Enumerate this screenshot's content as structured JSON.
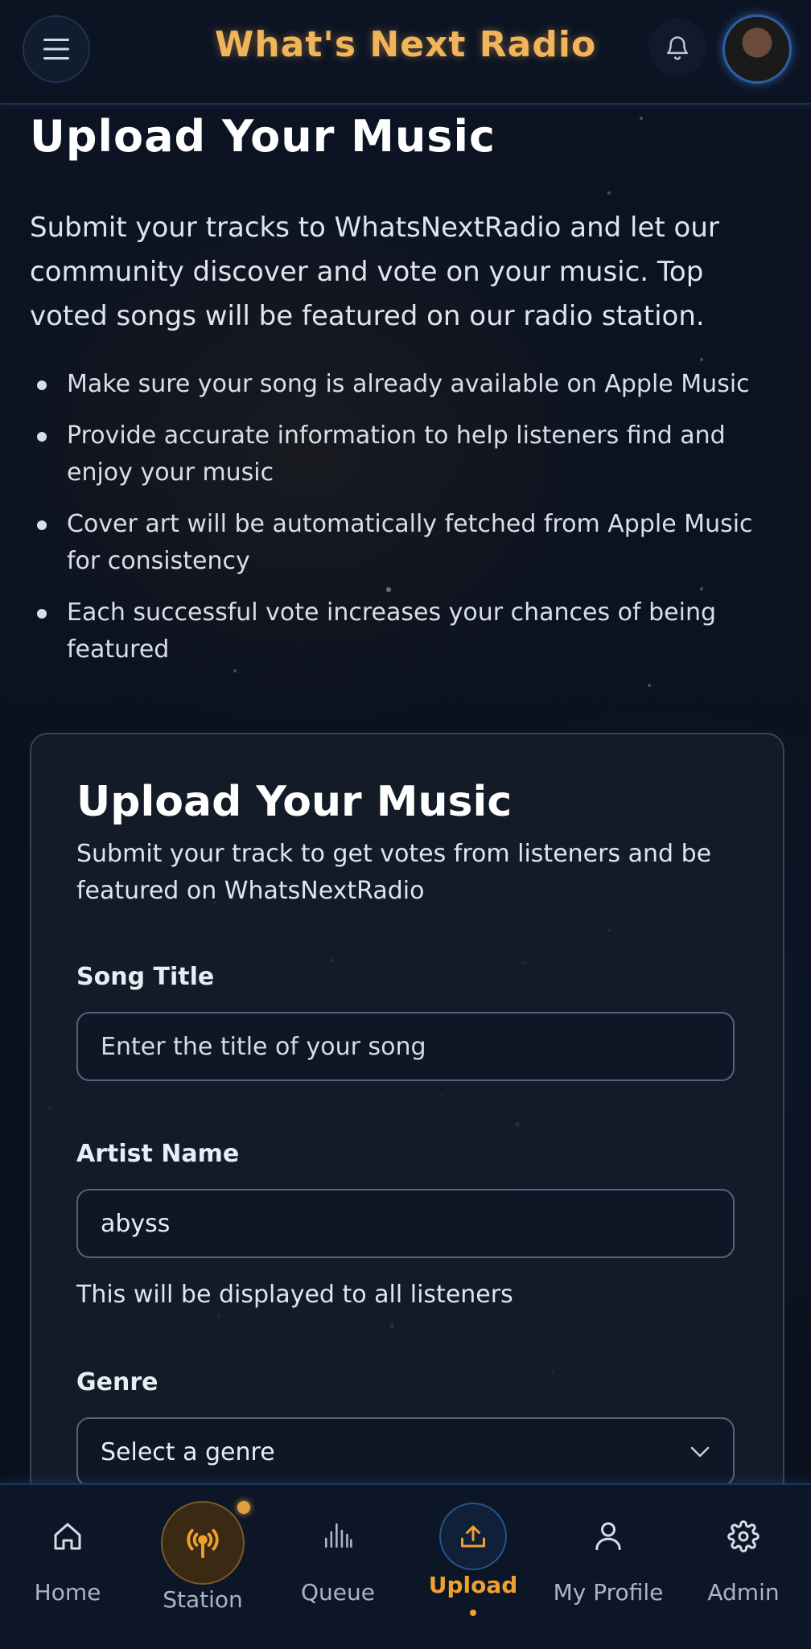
{
  "header": {
    "app_title": "What's Next Radio",
    "menu_icon": "hamburger-menu-icon",
    "bell_icon": "bell-icon",
    "avatar": "user-avatar",
    "accent_color": "#f0b45a"
  },
  "intro": {
    "title": "Upload Your Music",
    "description": "Submit your tracks to WhatsNextRadio and let our community discover and vote on your music. Top voted songs will be featured on our radio station.",
    "tips": [
      "Make sure your song is already available on Apple Music",
      "Provide accurate information to help listeners find and enjoy your music",
      "Cover art will be automatically fetched from Apple Music for consistency",
      "Each successful vote increases your chances of being featured"
    ]
  },
  "form": {
    "title": "Upload Your Music",
    "subtitle": "Submit your track to get votes from listeners and be featured on WhatsNextRadio",
    "song_title": {
      "label": "Song Title",
      "placeholder": "Enter the title of your song",
      "value": ""
    },
    "artist_name": {
      "label": "Artist Name",
      "value": "abyss",
      "hint": "This will be displayed to all listeners"
    },
    "genre": {
      "label": "Genre",
      "selected": "Select a genre"
    }
  },
  "nav": {
    "items": [
      {
        "label": "Home",
        "icon": "home-icon"
      },
      {
        "label": "Station",
        "icon": "broadcast-icon"
      },
      {
        "label": "Queue",
        "icon": "equalizer-icon"
      },
      {
        "label": "Upload",
        "icon": "upload-icon",
        "active": true
      },
      {
        "label": "My Profile",
        "icon": "user-icon"
      },
      {
        "label": "Admin",
        "icon": "gear-icon"
      }
    ],
    "active_color": "#f0a030"
  }
}
